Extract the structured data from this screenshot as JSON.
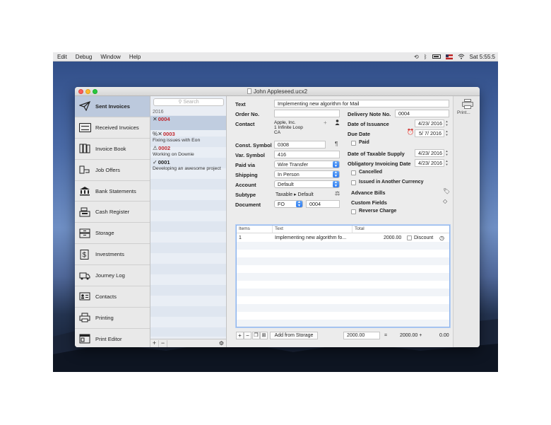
{
  "menubar": {
    "items": [
      "Edit",
      "Debug",
      "Window",
      "Help"
    ],
    "clock": "Sat 5:55:5"
  },
  "window": {
    "title": "John Appleseed.ucx2"
  },
  "sidebar": {
    "items": [
      {
        "label": "Sent Invoices",
        "icon": "paper-plane-icon",
        "active": true
      },
      {
        "label": "Received Invoices",
        "icon": "inbox-icon"
      },
      {
        "label": "Invoice Book",
        "icon": "books-icon"
      },
      {
        "label": "Job Offers",
        "icon": "handshake-icon"
      },
      {
        "label": "Bank Statements",
        "icon": "bank-icon"
      },
      {
        "label": "Cash Register",
        "icon": "cash-register-icon"
      },
      {
        "label": "Storage",
        "icon": "storage-box-icon"
      },
      {
        "label": "Investments",
        "icon": "dollar-icon"
      },
      {
        "label": "Journey Log",
        "icon": "truck-icon"
      },
      {
        "label": "Contacts",
        "icon": "contact-card-icon"
      },
      {
        "label": "Printing",
        "icon": "printer-icon"
      },
      {
        "label": "Print Editor",
        "icon": "print-editor-icon"
      }
    ]
  },
  "list": {
    "search_placeholder": "Search",
    "year": "2016",
    "invoices": [
      {
        "mark": "✕",
        "number": "0004",
        "desc": ""
      },
      {
        "mark": "%✕",
        "number": "0003",
        "desc": "Fixing issues with Eon"
      },
      {
        "mark": "⚠",
        "number": "0002",
        "desc": "Working on Downie"
      },
      {
        "mark": "✓",
        "number": "0001",
        "desc": "Developing an awesome project"
      }
    ],
    "footer": {
      "add": "+",
      "remove": "−",
      "settings": "⚙"
    }
  },
  "detail": {
    "labels": {
      "text": "Text",
      "order_no": "Order No.",
      "contact": "Contact",
      "const_symbol": "Const. Symbol",
      "var_symbol": "Var. Symbol",
      "paid_via": "Paid via",
      "shipping": "Shipping",
      "account": "Account",
      "subtype": "Subtype",
      "document": "Document",
      "delivery_note_no": "Delivery Note No.",
      "date_of_issuance": "Date of Issuance",
      "due_date": "Due Date",
      "paid": "Paid",
      "date_of_taxable_supply": "Date of Taxable Supply",
      "obligatory_invoicing_date": "Obligatory Invoicing Date",
      "cancelled": "Cancelled",
      "issued_in_another_currency": "Issued in Another Currency",
      "advance_bills": "Advance Bills",
      "custom_fields": "Custom Fields",
      "reverse_charge": "Reverse Charge"
    },
    "values": {
      "text": "Implementing new algorithm for Mail",
      "order_no": "",
      "contact_line1": "Apple, Inc.",
      "contact_line2": "1 Infinite Loop",
      "contact_line3": "CA",
      "const_symbol": "0308",
      "var_symbol": "416",
      "paid_via": "Wire Transfer",
      "shipping": "In Person",
      "account": "Default",
      "subtype": "Taxable ▸ Default",
      "document_type": "FO",
      "document_number": "0004",
      "delivery_note_no": "0004",
      "date_of_issuance": "4/23/ 2016",
      "due_date": "5/  7/ 2016",
      "date_of_taxable_supply": "4/23/ 2016",
      "obligatory_invoicing_date": "4/23/ 2016"
    },
    "table": {
      "headers": [
        "Items",
        "Text",
        "Total"
      ],
      "rows": [
        {
          "items": "1",
          "text": "Implementing new algorithm fo...",
          "total": "2000.00",
          "discount_label": "Discount"
        }
      ]
    },
    "footer": {
      "add_from_storage": "Add from Storage",
      "amount": "2000.00",
      "equals": "=",
      "sum": "2000.00 +",
      "extra": "0.00"
    }
  },
  "right_toolbar": {
    "print_label": "Print..."
  }
}
